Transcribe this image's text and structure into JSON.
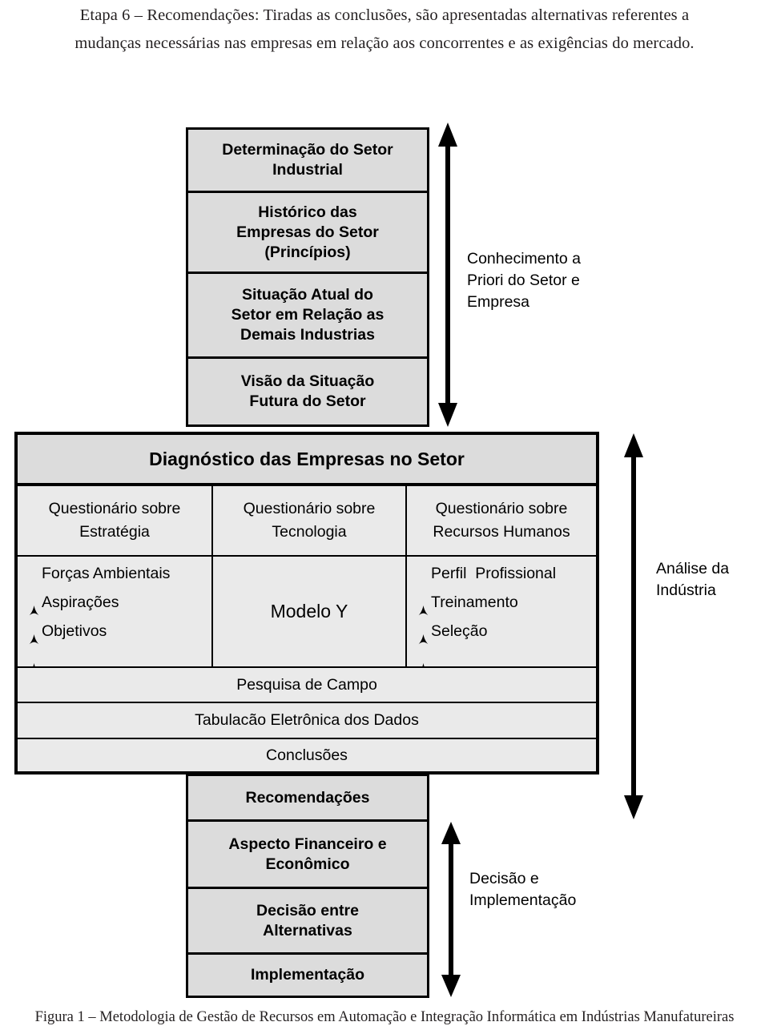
{
  "intro": {
    "line1": "Etapa 6 – Recomendações: Tiradas as conclusões, são apresentadas alternativas referentes a",
    "line2": "mudanças necessárias nas empresas em relação aos concorrentes e as exigências do mercado."
  },
  "top_stack": [
    {
      "label": "Determinação do Setor\nIndustrial"
    },
    {
      "label": "Histórico das\nEmpresas do Setor\n(Princípios)"
    },
    {
      "label": "Situação Atual  do\nSetor em Relação as\nDemais Industrias"
    },
    {
      "label": "Visão da Situação\nFutura do Setor"
    }
  ],
  "side_labels": {
    "knowledge": "Conhecimento a\nPriori do Setor e\nEmpresa",
    "industry_analysis": "Análise da\nIndústria",
    "decision": "Decisão e\nImplementação"
  },
  "diagnostic": {
    "header": "Diagnóstico das Empresas no Setor",
    "columns": [
      {
        "head": "Questionário sobre\nEstratégia",
        "items": [
          "Forças Ambientais",
          "Aspirações",
          "Objetivos"
        ],
        "center_text": ""
      },
      {
        "head": "Questionário sobre\nTecnologia",
        "items": [],
        "center_text": "Modelo Y"
      },
      {
        "head": "Questionário sobre\nRecursos Humanos",
        "items": [
          "Perfil  Profissional",
          "Treinamento",
          "Seleção"
        ],
        "center_text": ""
      }
    ],
    "rows": [
      "Pesquisa de Campo",
      "Tabulacão Eletrônica dos Dados",
      "Conclusões"
    ]
  },
  "bottom_stack": [
    {
      "label": "Recomendações"
    },
    {
      "label": "Aspecto Financeiro e\nEconômico"
    },
    {
      "label": "Decisão entre\nAlternativas"
    },
    {
      "label": "Implementação"
    }
  ],
  "caption": "Figura 1 – Metodologia de Gestão de Recursos em Automação e Integração Informática em Indústrias Manufatureiras",
  "colors": {
    "box_fill_dark": "#dcdcdc",
    "box_fill_light": "#eaeaea",
    "stroke": "#000000",
    "text": "#000000",
    "body_text": "#231f20"
  }
}
